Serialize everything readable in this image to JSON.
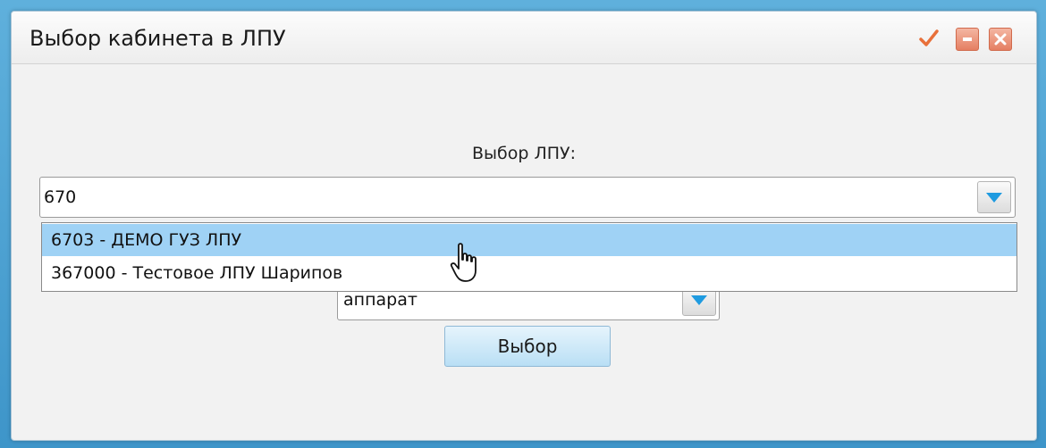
{
  "window": {
    "title": "Выбор кабинета в ЛПУ"
  },
  "titlebar_buttons": {
    "confirm_icon": "checkmark-icon",
    "minimize_icon": "minimize-icon",
    "close_icon": "close-icon"
  },
  "form": {
    "lpu_label": "Выбор ЛПУ:",
    "lpu_input_value": "670",
    "lpu_dropdown_items": [
      "6703 - ДЕМО ГУЗ ЛПУ",
      "367000 - Тестовое ЛПУ Шарипов"
    ],
    "type_value": "аппарат",
    "select_button_label": "Выбор"
  },
  "colors": {
    "accent": "#1f9be0",
    "selected_item_bg": "#9fd2f5",
    "close_button": "#e57f62",
    "check_mark": "#e8703a"
  }
}
